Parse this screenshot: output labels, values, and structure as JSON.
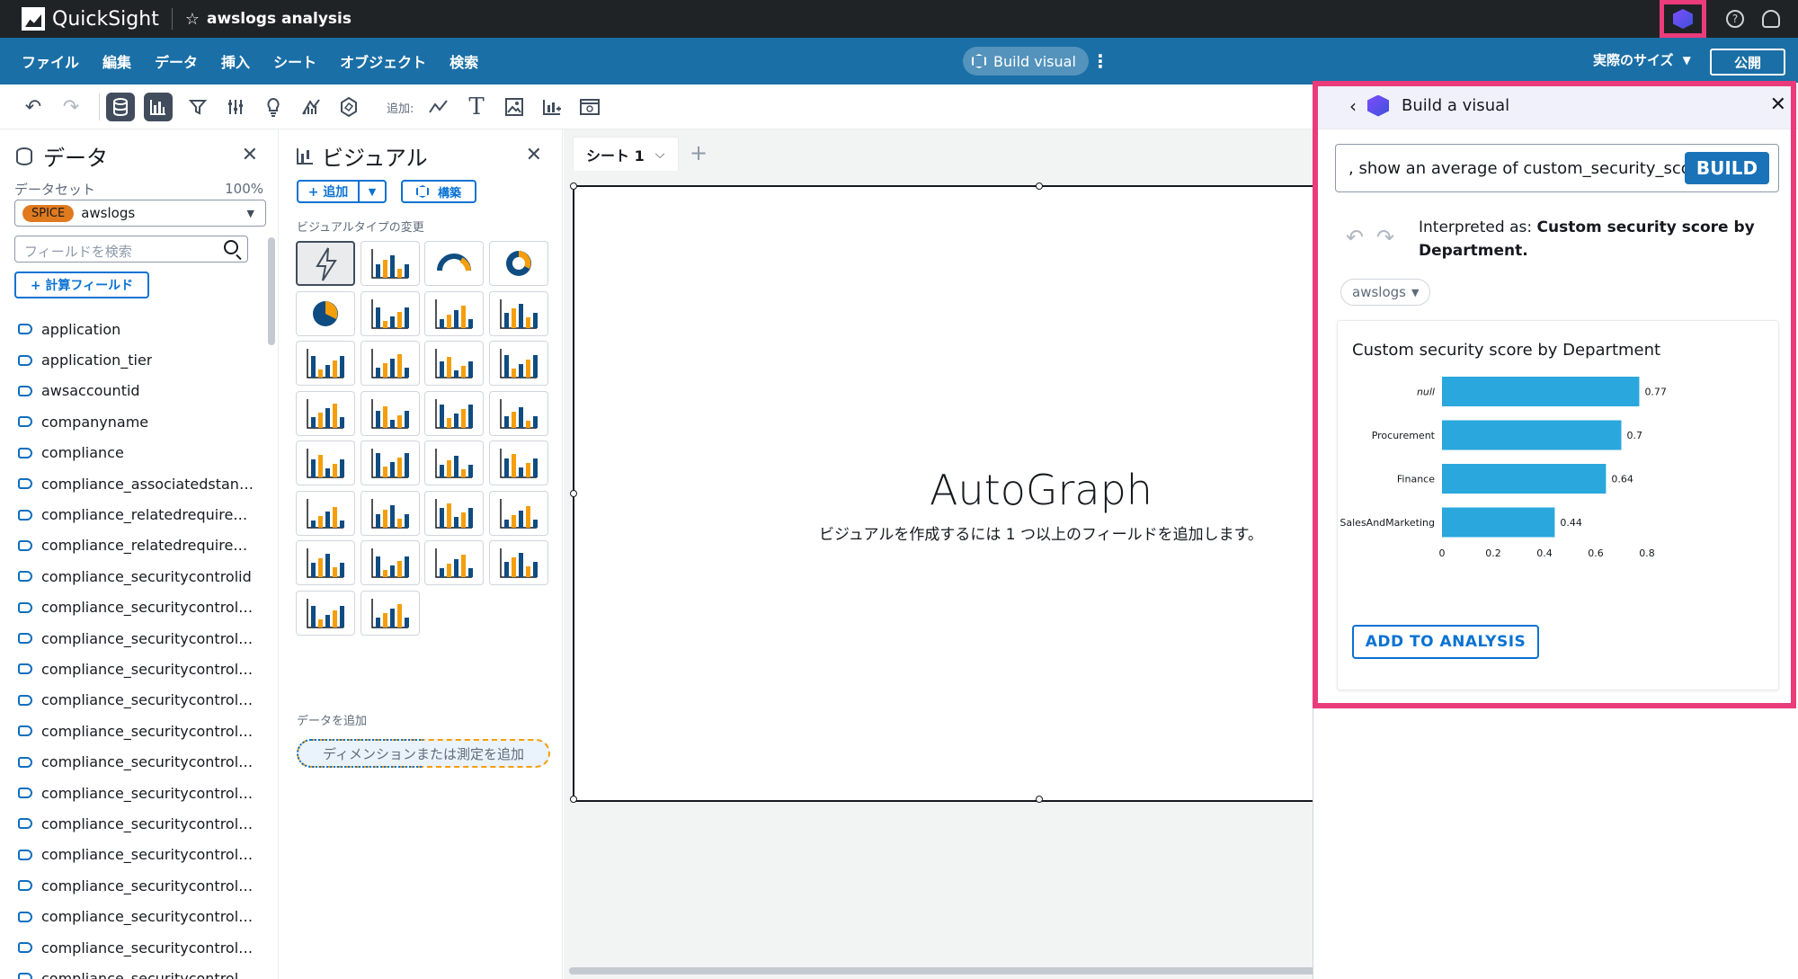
{
  "app": {
    "name": "QuickSight",
    "analysis_title": "awslogs analysis"
  },
  "menu": {
    "items": [
      "ファイル",
      "編集",
      "データ",
      "挿入",
      "シート",
      "オブジェクト",
      "検索"
    ],
    "build_visual": "Build visual",
    "size_label": "実際のサイズ",
    "publish": "公開"
  },
  "toolbar": {
    "add_label": "追加:"
  },
  "data_panel": {
    "title": "データ",
    "dataset_label": "データセット",
    "dataset_pct": "100%",
    "spice": "SPICE",
    "dataset_name": "awslogs",
    "search_placeholder": "フィールドを検索",
    "calc_field": "+ 計算フィールド",
    "fields": [
      "application",
      "application_tier",
      "awsaccountid",
      "companyname",
      "compliance",
      "compliance_associatedstanda...",
      "compliance_relatedrequireme...",
      "compliance_relatedrequireme...",
      "compliance_securitycontrolid",
      "compliance_securitycontrolpa...",
      "compliance_securitycontrolpa...",
      "compliance_securitycontrolpa...",
      "compliance_securitycontrolpa...",
      "compliance_securitycontrolpa...",
      "compliance_securitycontrolpa...",
      "compliance_securitycontrolpa...",
      "compliance_securitycontrolpa...",
      "compliance_securitycontrolpa...",
      "compliance_securitycontrolpa...",
      "compliance_securitycontrolpa...",
      "compliance_securitycontrolpa...",
      "compliance_securitycontrolpa..."
    ]
  },
  "visual_panel": {
    "title": "ビジュアル",
    "add": "+ 追加",
    "build": "構築",
    "type_label": "ビジュアルタイプの変更",
    "add_data_label": "データを追加",
    "dimension_well": "ディメンションまたは測定を追加"
  },
  "canvas": {
    "sheet_tab": "シート 1",
    "autograph_title": "AutoGraph",
    "autograph_sub": "ビジュアルを作成するには 1 つ以上のフィールドを追加します。"
  },
  "build_panel": {
    "title": "Build a visual",
    "query": ", show an average of custom_security_score",
    "build_button": "BUILD",
    "interpreted_prefix": "Interpreted as: ",
    "interpreted_value": "Custom security score by Department.",
    "dataset_chip": "awslogs",
    "add_to_analysis": "ADD TO ANALYSIS"
  },
  "chart_data": {
    "type": "bar",
    "orientation": "horizontal",
    "title": "Custom security score by Department",
    "categories": [
      "null",
      "Procurement",
      "Finance",
      "SalesAndMarketing"
    ],
    "values": [
      0.77,
      0.7,
      0.64,
      0.44
    ],
    "value_labels": [
      "0.77",
      "0.7",
      "0.64",
      "0.44"
    ],
    "xlim": [
      0,
      0.8
    ],
    "xticks": [
      "0",
      "0.2",
      "0.4",
      "0.6",
      "0.8"
    ],
    "bar_color": "#2aa7dd",
    "grid": false
  },
  "colors": {
    "accent_pink": "#ea3b7a",
    "menubar_blue": "#1a6fa6",
    "primary_blue": "#0972d3"
  }
}
